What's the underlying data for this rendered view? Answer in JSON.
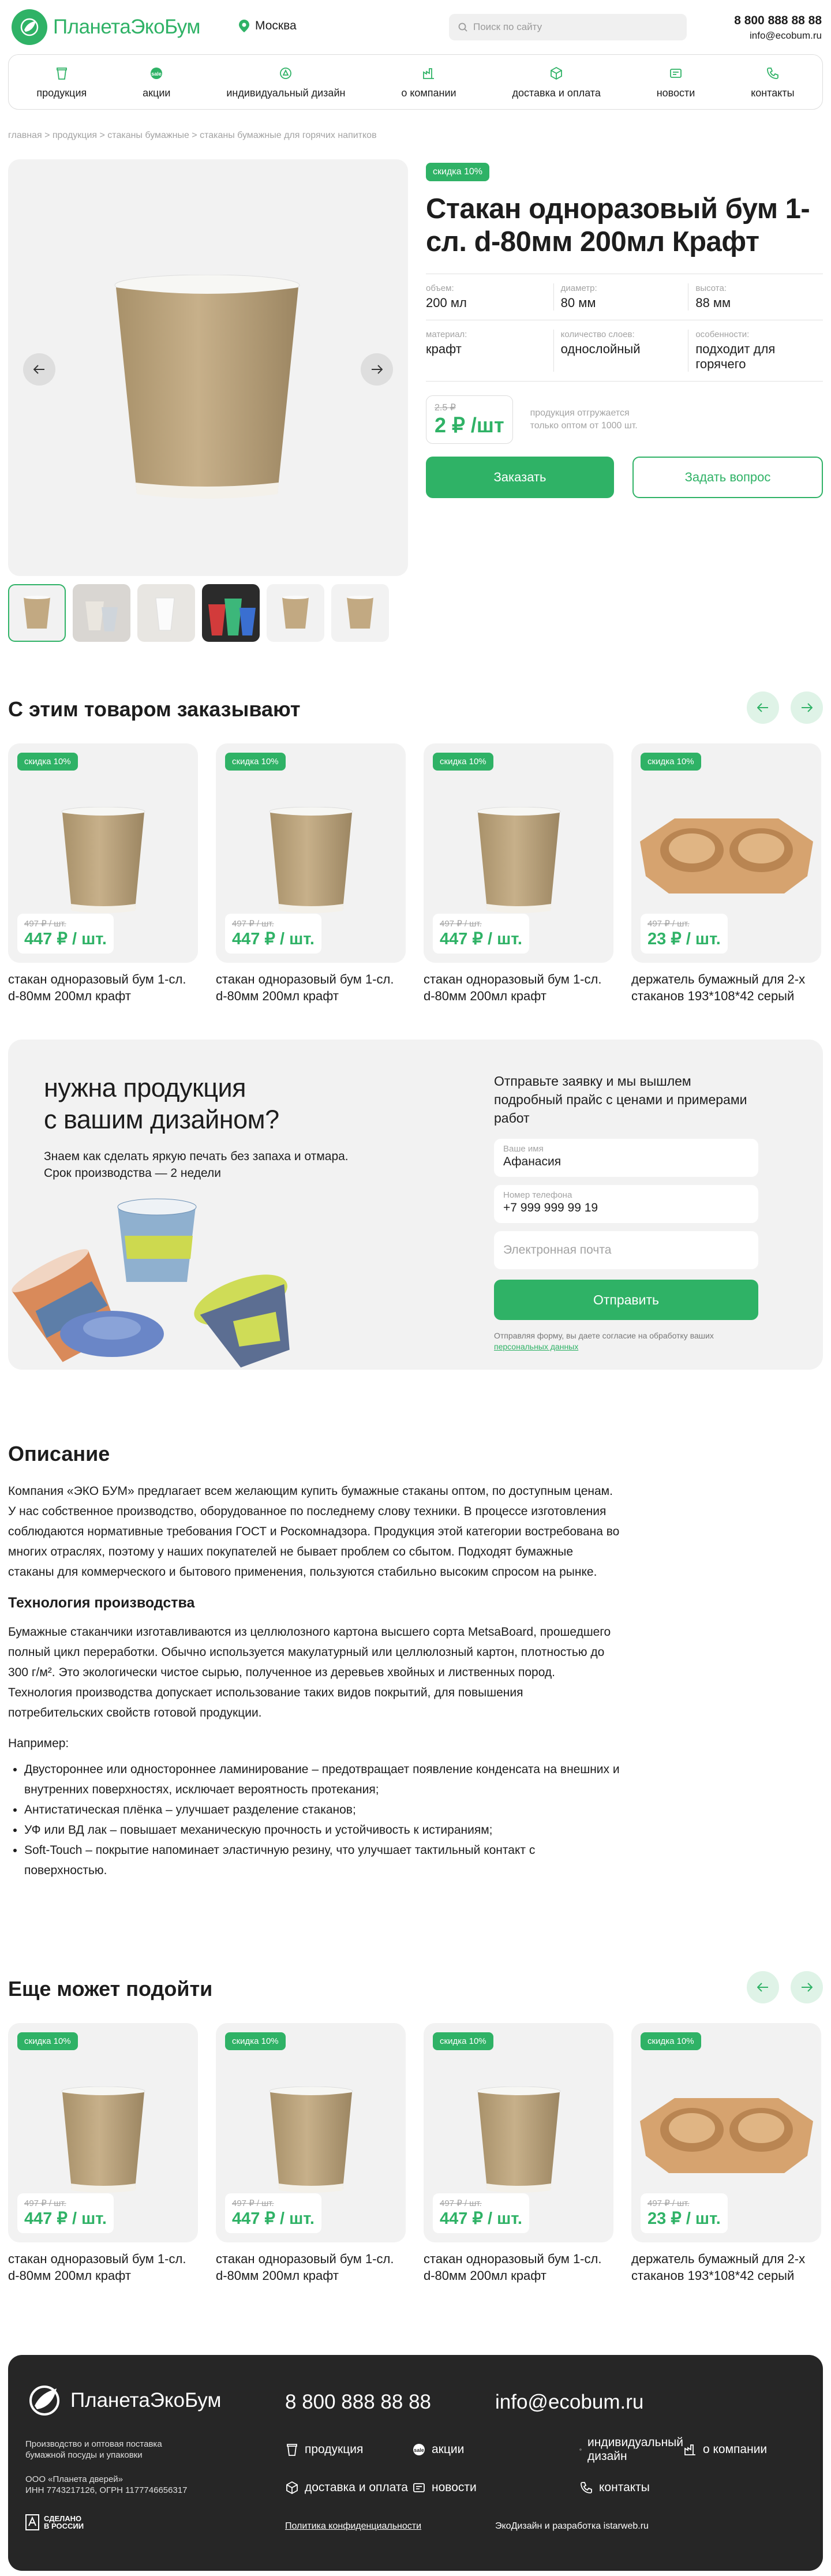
{
  "header": {
    "brand": "ПланетаЭкоБум",
    "city": "Москва",
    "search_placeholder": "Поиск по сайту",
    "phone": "8 800 888 88 88",
    "email": "info@ecobum.ru"
  },
  "nav": [
    {
      "label": "продукция",
      "icon": "cup-icon"
    },
    {
      "label": "акции",
      "icon": "sale-icon"
    },
    {
      "label": "индивидуальный дизайн",
      "icon": "design-icon"
    },
    {
      "label": "о компании",
      "icon": "factory-icon"
    },
    {
      "label": "доставка и оплата",
      "icon": "box-icon"
    },
    {
      "label": "новости",
      "icon": "news-icon"
    },
    {
      "label": "контакты",
      "icon": "phone-icon"
    }
  ],
  "breadcrumbs": "главная > продукция > стаканы бумажные > стаканы бумажные для горячих напитков",
  "product": {
    "badge": "скидка 10%",
    "title": "Стакан одноразовый бум 1-сл. d-80мм 200мл Крафт",
    "specs": [
      [
        {
          "k": "объем:",
          "v": "200 мл"
        },
        {
          "k": "диаметр:",
          "v": "80 мм"
        },
        {
          "k": "высота:",
          "v": "88 мм"
        }
      ],
      [
        {
          "k": "материал:",
          "v": "крафт"
        },
        {
          "k": "количество слоев:",
          "v": "однослойный"
        },
        {
          "k": "особенности:",
          "v": "подходит для горячего"
        }
      ]
    ],
    "old_price": "2.5 ₽",
    "price": "2 ₽ /шт",
    "note_line1": "продукция отгружается",
    "note_line2": "только оптом от 1000 шт.",
    "order_label": "Заказать",
    "ask_label": "Задать вопрос"
  },
  "ordered_with": {
    "title": "С этим товаром заказывают",
    "items": [
      {
        "badge": "скидка 10%",
        "old": "497 ₽ / шт.",
        "price": "447 ₽ / шт.",
        "name": "стакан одноразовый бум 1-сл. d-80мм 200мл крафт",
        "kind": "cup"
      },
      {
        "badge": "скидка 10%",
        "old": "497 ₽ / шт.",
        "price": "447 ₽ / шт.",
        "name": "стакан одноразовый бум 1-сл. d-80мм 200мл крафт",
        "kind": "cup"
      },
      {
        "badge": "скидка 10%",
        "old": "497 ₽ / шт.",
        "price": "447 ₽ / шт.",
        "name": "стакан одноразовый бум 1-сл. d-80мм 200мл крафт",
        "kind": "cup"
      },
      {
        "badge": "скидка 10%",
        "old": "497 ₽ / шт.",
        "price": "23 ₽ / шт.",
        "name": "держатель бумажный для 2-х стаканов 193*108*42 серый",
        "kind": "holder"
      }
    ]
  },
  "design": {
    "heading_line1": "нужна продукция",
    "heading_line2": "с вашим дизайном?",
    "text_line1": "Знаем как сделать яркую печать без запаха и отмара.",
    "text_line2": "Срок производства — 2 недели",
    "form_lead": "Отправьте заявку и мы вышлем подробный прайс с ценами и примерами работ",
    "name_label": "Ваше имя",
    "name_value": "Афанасия",
    "phone_label": "Номер телефона",
    "phone_value": "+7 999 999 99 19",
    "email_placeholder": "Электронная почта",
    "submit": "Отправить",
    "consent": "Отправляя форму, вы даете согласие на обработку ваших",
    "consent_link": "персональных данных"
  },
  "description": {
    "title": "Описание",
    "p1": "Компания «ЭКО БУМ» предлагает всем желающим купить бумажные стаканы оптом, по доступным ценам. У нас собственное производство, оборудованное по последнему слову техники. В процессе изготовления соблюдаются нормативные требования ГОСТ и Роскомнадзора. Продукция этой категории востребована во многих отраслях, поэтому у наших покупателей не бывает проблем со сбытом. Подходят бумажные стаканы для коммерческого и бытового применения, пользуются стабильно высоким спросом на рынке.",
    "h2": "Технология производства",
    "p2": "Бумажные стаканчики изготавливаются из целлюлозного картона высшего сорта MetsaBoard, прошедшего полный цикл переработки. Обычно используется макулатурный или целлюлозный картон, плотностью до 300 г/м². Это экологически чистое сырью, полученное из деревьев хвойных и лиственных пород. Технология производства допускает использование таких видов покрытий, для повышения потребительских свойств готовой продукции.",
    "p3": "Например:",
    "list": [
      "Двустороннее или одностороннее ламинирование – предотвращает появление конденсата на внешних и внутренних поверхностях, исключает вероятность протекания;",
      "Антистатическая плёнка – улучшает разделение стаканов;",
      "УФ или ВД лак – повышает механическую прочность и устойчивость к истираниям;",
      "Soft-Touch – покрытие напоминает эластичную резину, что улучшает тактильный контакт с поверхностью."
    ]
  },
  "may_fit": {
    "title": "Еще может подойти",
    "items": [
      {
        "badge": "скидка 10%",
        "old": "497 ₽ / шт.",
        "price": "447 ₽ / шт.",
        "name": "стакан одноразовый бум 1-сл. d-80мм 200мл крафт",
        "kind": "cup"
      },
      {
        "badge": "скидка 10%",
        "old": "497 ₽ / шт.",
        "price": "447 ₽ / шт.",
        "name": "стакан одноразовый бум 1-сл. d-80мм 200мл крафт",
        "kind": "cup"
      },
      {
        "badge": "скидка 10%",
        "old": "497 ₽ / шт.",
        "price": "447 ₽ / шт.",
        "name": "стакан одноразовый бум 1-сл. d-80мм 200мл крафт",
        "kind": "cup"
      },
      {
        "badge": "скидка 10%",
        "old": "497 ₽ / шт.",
        "price": "23 ₽ / шт.",
        "name": "держатель бумажный для 2-х стаканов 193*108*42 серый",
        "kind": "holder"
      }
    ]
  },
  "footer": {
    "brand": "ПланетаЭкоБум",
    "phone": "8 800 888 88 88",
    "email": "info@ecobum.ru",
    "about_line1": "Производство и оптовая поставка",
    "about_line2": "бумажной посуды и упаковки",
    "org_line1": "ООО «Планета дверей»",
    "org_line2": "ИНН 7743217126, ОГРН 1177746656317",
    "made_line1": "СДЕЛАНО",
    "made_line2": "В РОССИИ",
    "links": [
      {
        "label": "продукция",
        "icon": "cup-icon"
      },
      {
        "label": "акции",
        "icon": "sale-icon"
      },
      {
        "label": "индивидуальный дизайн",
        "icon": "design-icon"
      },
      {
        "label": "о компании",
        "icon": "factory-icon"
      },
      {
        "label": "доставка и оплата",
        "icon": "box-icon"
      },
      {
        "label": "новости",
        "icon": "news-icon"
      },
      {
        "label": "контакты",
        "icon": "phone-icon"
      }
    ],
    "policy": "Политика конфиденциальности",
    "dev": "ЭкоДизайн и разработка istarweb.ru"
  },
  "colors": {
    "accent": "#2fb266",
    "footer_bg": "#262626",
    "card_bg": "#f2f2f2"
  }
}
